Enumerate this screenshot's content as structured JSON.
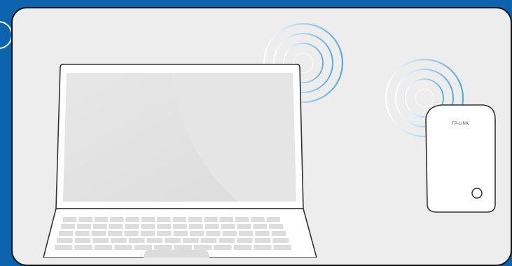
{
  "device": {
    "brand_label": "TP-LINK"
  },
  "colors": {
    "frame_blue": "#0b64ad",
    "panel_bg": "#ededed",
    "wave_blue": "#5aa9d6"
  },
  "icons": {
    "laptop": "laptop-icon",
    "extender": "range-extender-icon",
    "wifi_waves": "wifi-waves-icon"
  }
}
